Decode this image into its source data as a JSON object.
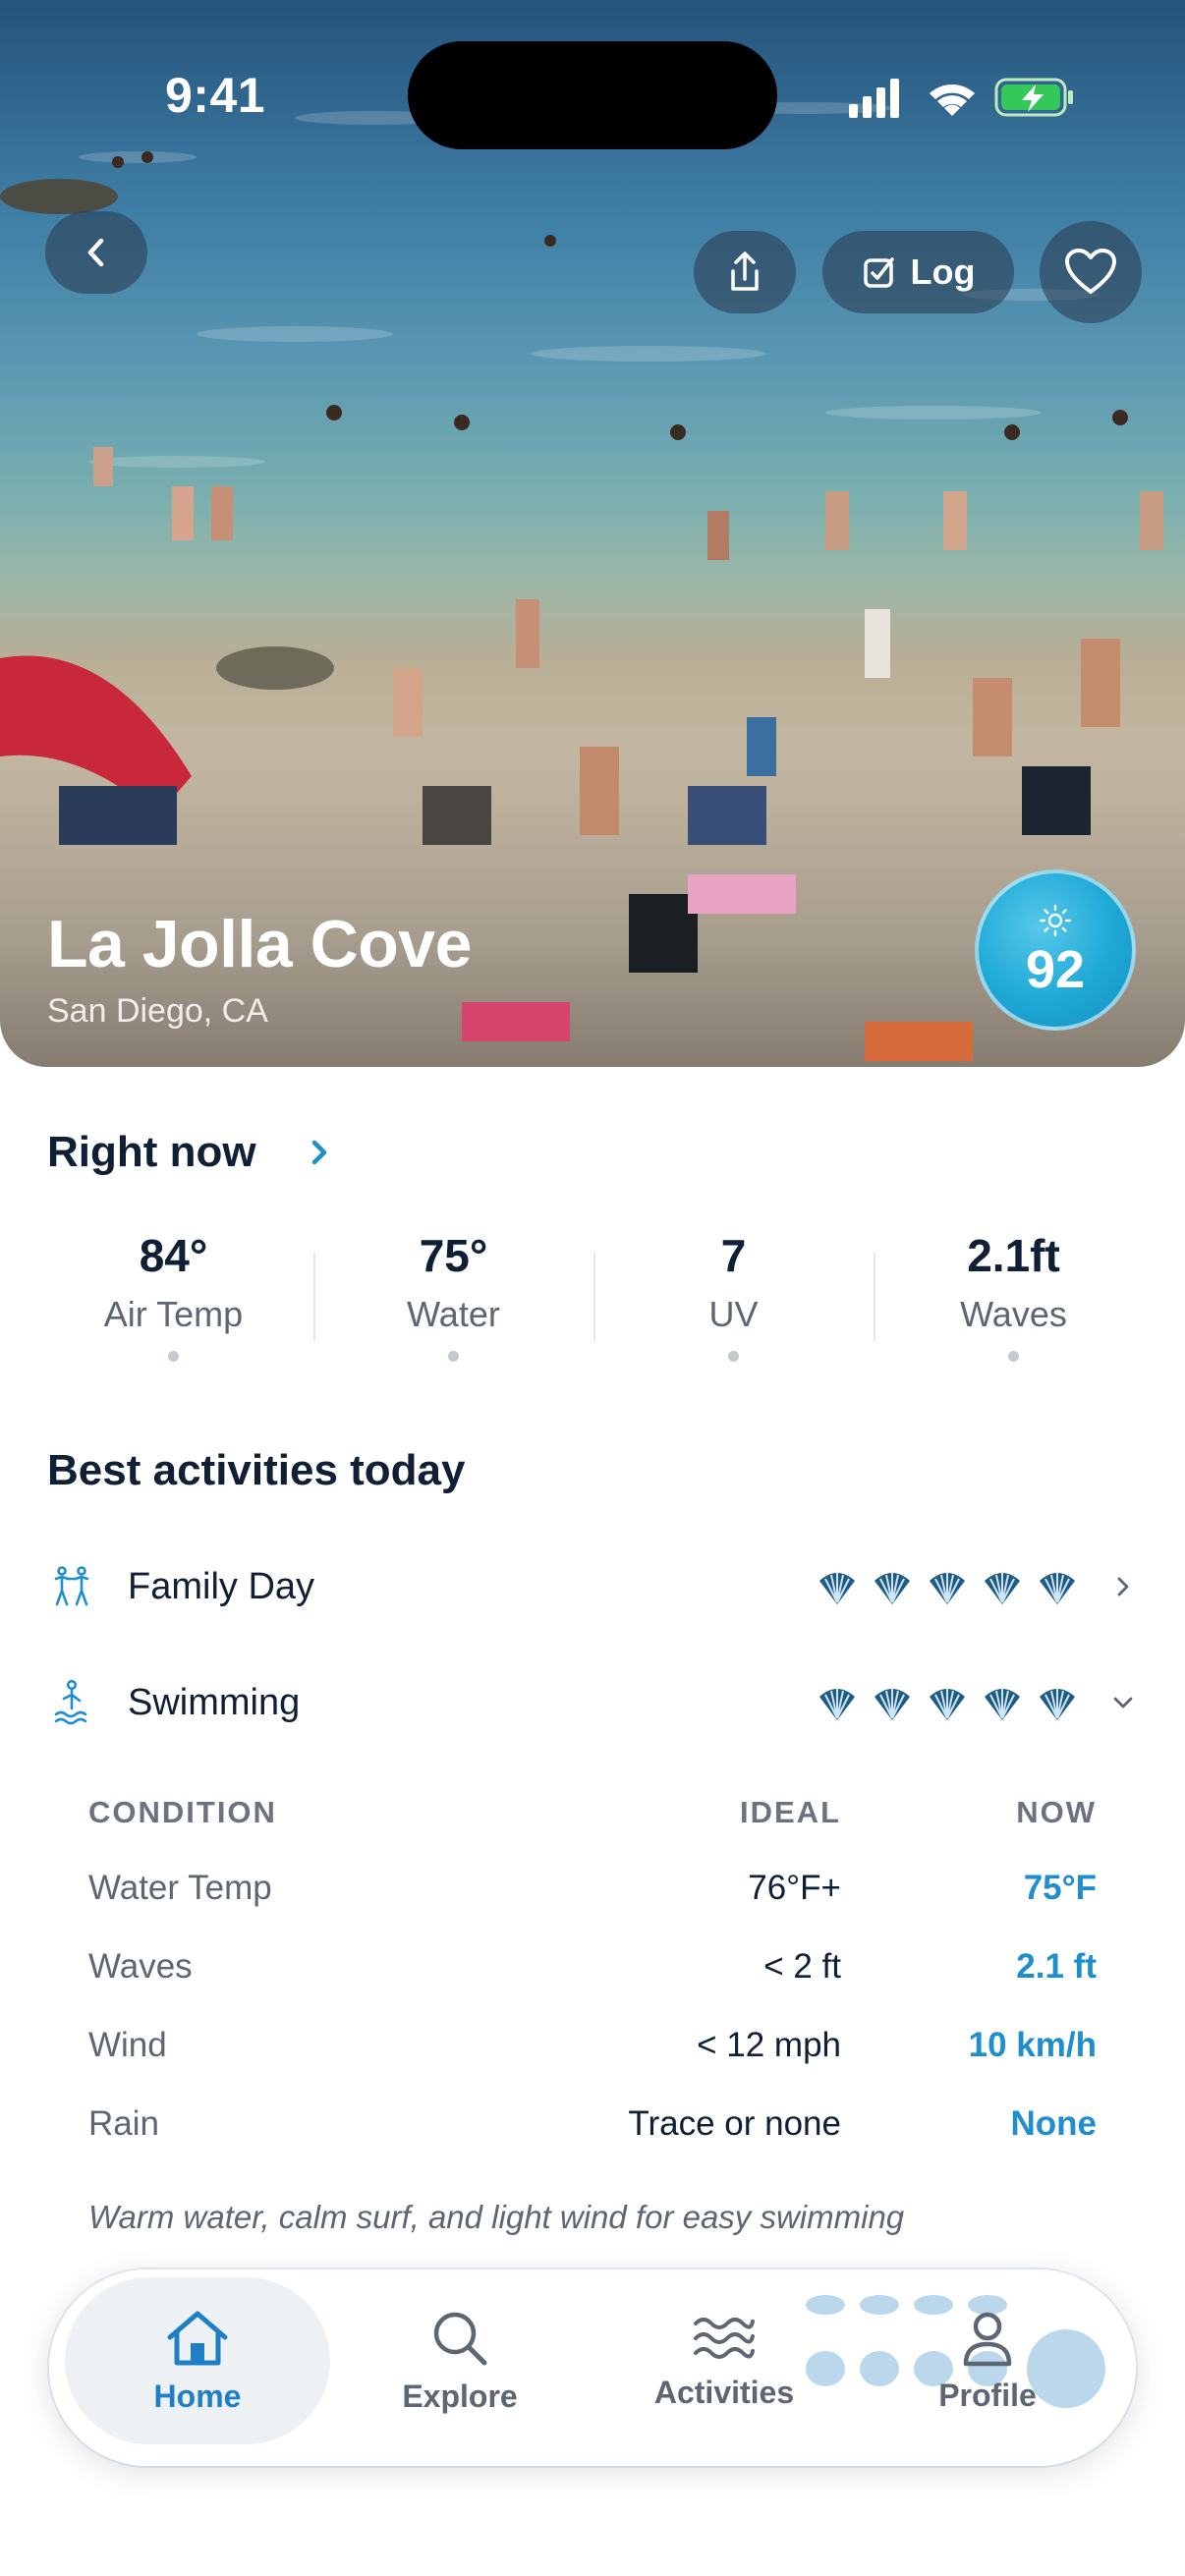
{
  "status_bar": {
    "time": "9:41"
  },
  "hero": {
    "log_label": "Log",
    "place_name": "La Jolla Cove",
    "location": "San Diego, CA",
    "score": "92"
  },
  "right_now": {
    "title": "Right now",
    "stats": [
      {
        "value": "84°",
        "label": "Air Temp"
      },
      {
        "value": "75°",
        "label": "Water"
      },
      {
        "value": "7",
        "label": "UV"
      },
      {
        "value": "2.1ft",
        "label": "Waves"
      }
    ]
  },
  "activities": {
    "title": "Best activities today",
    "items": [
      {
        "label": "Family Day",
        "icon": "family-icon",
        "rating": 5
      },
      {
        "label": "Swimming",
        "icon": "swimming-icon",
        "rating": 5
      }
    ]
  },
  "conditions": {
    "headers": [
      "CONDITION",
      "IDEAL",
      "NOW"
    ],
    "rows": [
      [
        "Water Temp",
        "76°F+",
        "75°F"
      ],
      [
        "Waves",
        "< 2 ft",
        "2.1 ft"
      ],
      [
        "Wind",
        "< 12 mph",
        "10 km/h"
      ],
      [
        "Rain",
        "Trace or none",
        "None"
      ]
    ],
    "note": "Warm water, calm surf, and light wind for easy swimming"
  },
  "tabbar": {
    "tabs": [
      {
        "label": "Home",
        "icon": "home-icon",
        "active": true
      },
      {
        "label": "Explore",
        "icon": "search-icon"
      },
      {
        "label": "Activities",
        "icon": "waves-icon"
      },
      {
        "label": "Profile",
        "icon": "person-icon"
      }
    ]
  },
  "colors": {
    "accent": "#1e8ed0",
    "score_badge": "#1ea8d6",
    "text_primary": "#0f1f36",
    "text_secondary": "#5d6673"
  }
}
